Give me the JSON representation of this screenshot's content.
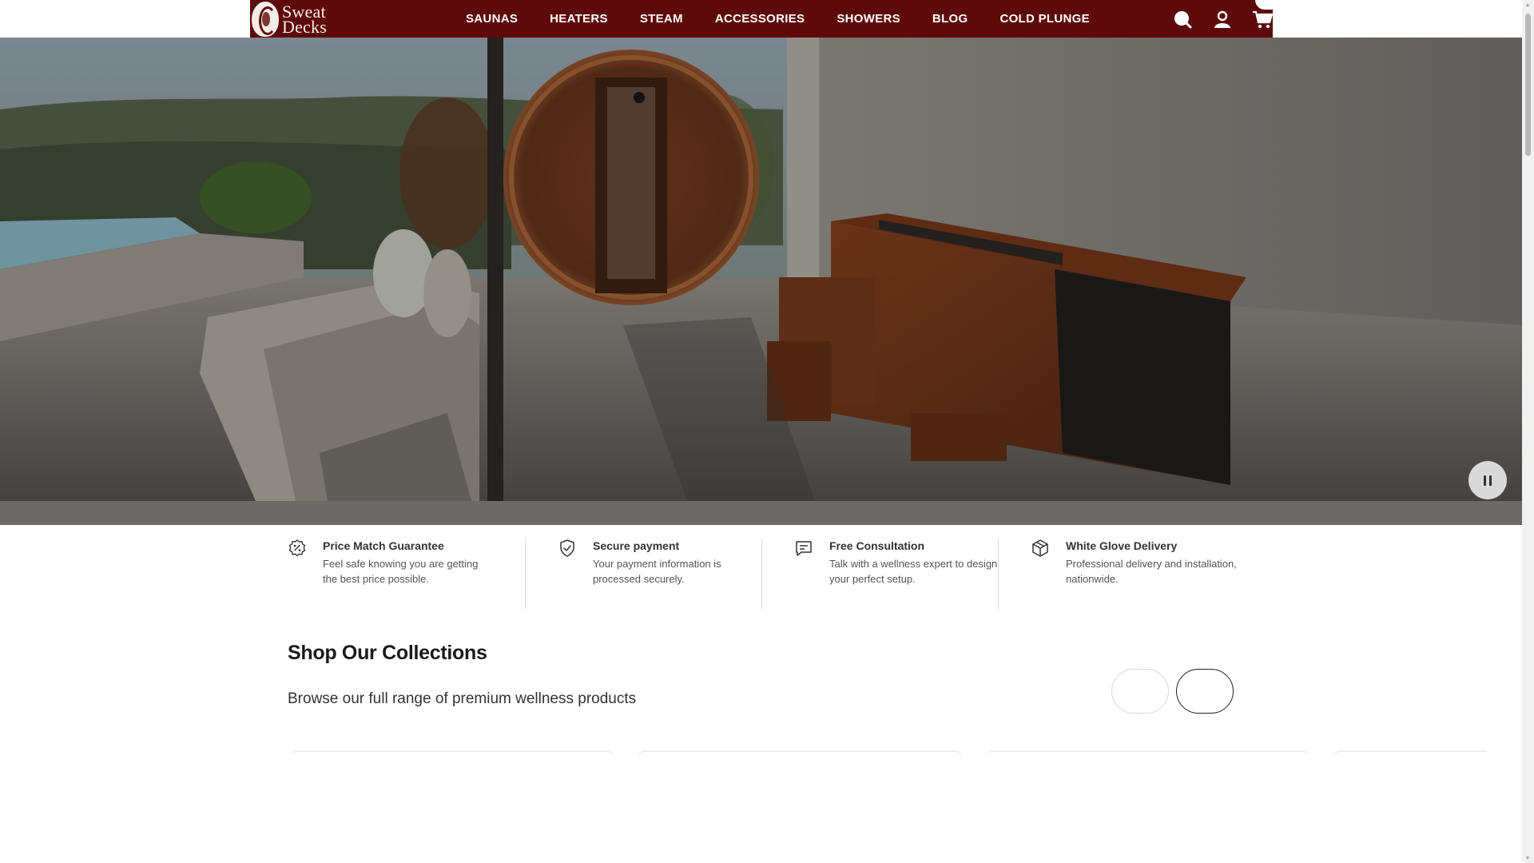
{
  "brand": {
    "line1": "Sweat",
    "line2": "Decks",
    "logo_icon": "face-profile-logo-icon"
  },
  "nav": {
    "items": [
      "SAUNAS",
      "HEATERS",
      "STEAM",
      "ACCESSORIES",
      "SHOWERS",
      "BLOG",
      "COLD PLUNGE"
    ]
  },
  "header_icons": [
    "search-icon",
    "account-icon",
    "cart-icon"
  ],
  "hero": {
    "control_icon": "pause-icon"
  },
  "features": [
    {
      "icon": "percent-badge-icon",
      "title": "Price Match Guarantee",
      "desc": "Feel safe knowing you are getting the best price possible."
    },
    {
      "icon": "shield-check-icon",
      "title": "Secure payment",
      "desc": "Your payment information is processed securely."
    },
    {
      "icon": "chat-bubble-icon",
      "title": "Free Consultation",
      "desc": "Talk with a wellness expert to design your perfect setup."
    },
    {
      "icon": "box-icon",
      "title": "White Glove Delivery",
      "desc": "Professional delivery and installation, nationwide."
    }
  ],
  "collections": {
    "title": "Shop Our Collections",
    "subtitle": "Browse our full range of premium wellness products"
  },
  "colors": {
    "header_bg": "#5e0a0a",
    "text_dark": "#1a1a1a",
    "divider": "#dddddd"
  }
}
